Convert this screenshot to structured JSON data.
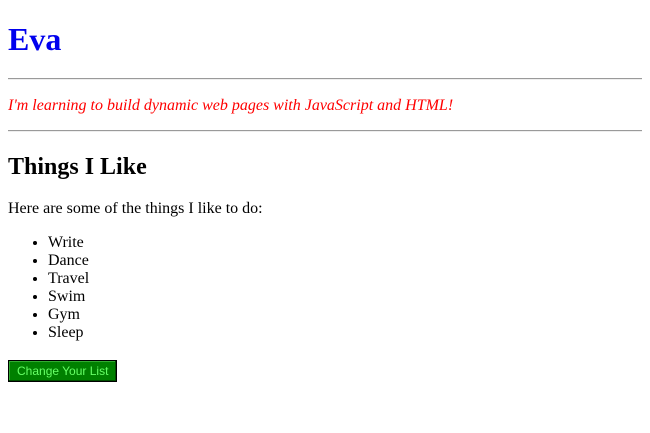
{
  "header": {
    "name": "Eva",
    "name_color": "#0000ee",
    "tagline": "I'm learning to build dynamic web pages with JavaScript and HTML!",
    "tagline_color": "#ff0000"
  },
  "main": {
    "heading": "Things I Like",
    "intro": "Here are some of the things I like to do:",
    "likes": [
      "Write",
      "Dance",
      "Travel",
      "Swim",
      "Gym",
      "Sleep"
    ],
    "button": {
      "label": "Change Your List",
      "bg_color": "#008000",
      "text_color": "#66ff66"
    }
  }
}
